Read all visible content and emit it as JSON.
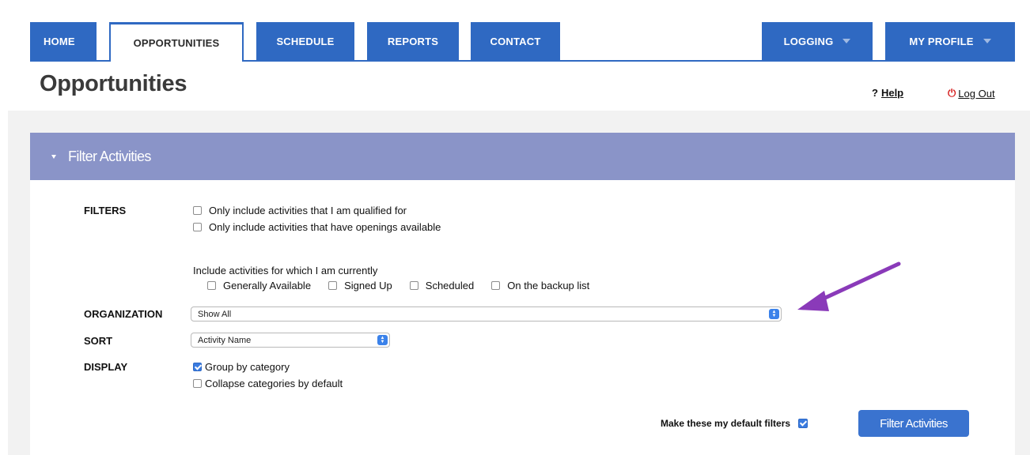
{
  "nav": {
    "tabs": [
      "HOME",
      "OPPORTUNITIES",
      "SCHEDULE",
      "REPORTS",
      "CONTACT"
    ],
    "active_tab": "OPPORTUNITIES",
    "right_tabs": [
      "LOGGING",
      "MY PROFILE"
    ]
  },
  "page": {
    "title": "Opportunities",
    "help_prefix": "?",
    "help_label": "Help",
    "logout_label": "Log Out"
  },
  "panel": {
    "title": "Filter Activities"
  },
  "filters": {
    "label": "FILTERS",
    "options": [
      {
        "label": "Only include activities that I am qualified for",
        "checked": false
      },
      {
        "label": "Only include activities that have openings available",
        "checked": false
      }
    ],
    "status_intro": "Include activities for which I am currently",
    "status_options": [
      {
        "label": "Generally Available",
        "checked": false
      },
      {
        "label": "Signed Up",
        "checked": false
      },
      {
        "label": "Scheduled",
        "checked": false
      },
      {
        "label": "On the backup list",
        "checked": false
      }
    ]
  },
  "organization": {
    "label": "ORGANIZATION",
    "selected": "Show All"
  },
  "sort": {
    "label": "SORT",
    "selected": "Activity Name"
  },
  "display": {
    "label": "DISPLAY",
    "options": [
      {
        "label": "Group by category",
        "checked": true
      },
      {
        "label": "Collapse categories by default",
        "checked": false
      }
    ]
  },
  "footer": {
    "default_label": "Make these my default filters",
    "default_checked": true,
    "submit_label": "Filter Activities"
  },
  "colors": {
    "nav_blue": "#2f69c2",
    "panel_header": "#8a94c8",
    "annotation_arrow": "#8a3ab9"
  }
}
